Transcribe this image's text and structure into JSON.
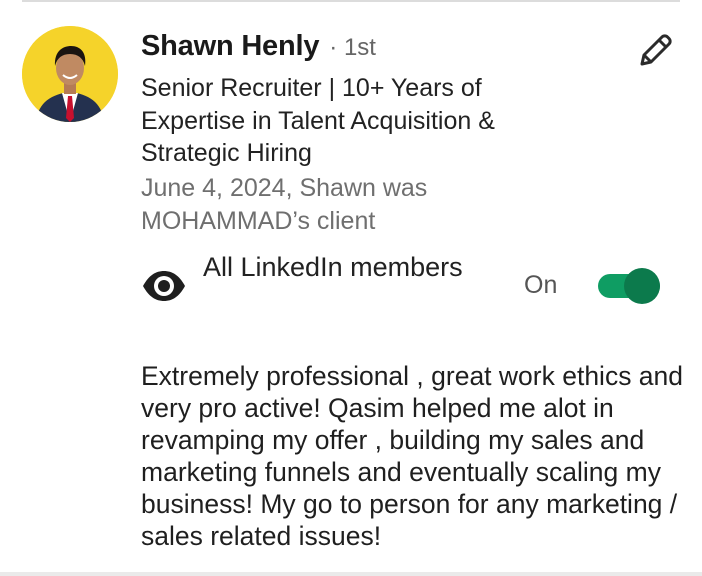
{
  "recommender": {
    "name": "Shawn Henly",
    "degree": "· 1st",
    "headline": "Senior Recruiter | 10+ Years of Expertise in Talent Acquisition & Strategic Hiring",
    "relation": "June 4, 2024, Shawn was MOHAMMAD’s client"
  },
  "visibility": {
    "label": "All LinkedIn members",
    "icon": "eye-icon",
    "toggle_state": "On",
    "enabled": true
  },
  "recommendation_text": "Extremely professional , great work ethics and very pro active! Qasim helped me alot in revamping my offer , building my sales and marketing funnels and eventually scaling my business! My go to person for any marketing / sales related issues!",
  "icons": {
    "edit": "pencil-icon"
  },
  "colors": {
    "toggle_track": "#0f9d63",
    "toggle_knob": "#0c7a4c",
    "avatar_bg": "#f5d32a",
    "secondary_text": "#6f6f6f"
  }
}
